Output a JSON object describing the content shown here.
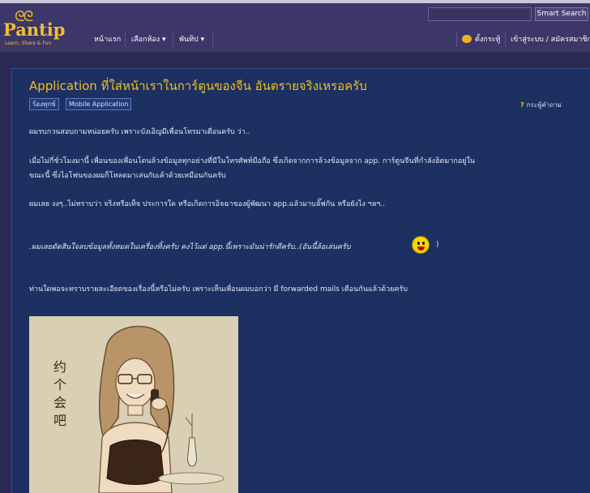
{
  "header": {
    "logo_text": "Pantip",
    "logo_tagline": "Learn, Share & Fun",
    "search_button": "Smart Search",
    "nav": {
      "home": "หน้าแรก",
      "rooms": "เลือกห้อง ▾",
      "tags": "พันทิป ▾",
      "new_topic": "ตั้งกระทู้",
      "login": "เข้าสู่ระบบ / สมัครสมาชิก"
    }
  },
  "post": {
    "title": "Application ที่ใส่หน้าเราในการ์ตูนของจีน อันตรายจริงเหรอครับ",
    "tags": [
      "ร้องทุกข์",
      "Mobile Application"
    ],
    "reply_label": "กระทู้คำถาม",
    "paragraphs": [
      "ผมรบกวนสอบถามหน่อยครับ เพราะบังเอิญมีเพื่อนโทรมาเตือนครับ ว่า..",
      "เมื่อไม่กี่ชั่วโมงมานี้ เพื่อนของเพื่อนโดนล้วงข้อมูลทุกอย่างที่มีในโทรศัพท์มือถือ ซึ่งเกิดจากการล้วงข้อมูลจาก app. การ์ตูนจีนที่กำลังฮิตมากอยู่ใน",
      "ขณะนี้ ซึ่งไอโฟนของผมก็โหลดมาเล่นกับเค้าด้วยเหมือนกันครับ",
      "ผมเลย งงๆ..ไม่ทราบว่า จริงหรือเท็จ ประการใด หรือเกิดการอิจฉาของผู้พัฒนา app.แล้วมาบลั๊ฟกัน หรือยังไง ฯลฯ..",
      ".ผมเลยตัดสินใจลบข้อมูลทั้งหมดในเครื่องทิ้งครับ คงไว้แต่ app.นี้เพราะมันน่ารักดีครับ..(อันนี้ล้อเล่นครับ",
      ")",
      "ท่านใดพอจะทราบรายละเอียดของเรื่องนี้หรือไม่ครับ เพราะเห็นเพื่อนผมบอกว่า มี forwarded mails เตือนกันแล้วด้วยครับ"
    ],
    "image_text": "约个会吧"
  },
  "colors": {
    "accent": "#f0c020",
    "panel": "#1c3062",
    "header": "#3d3668"
  }
}
